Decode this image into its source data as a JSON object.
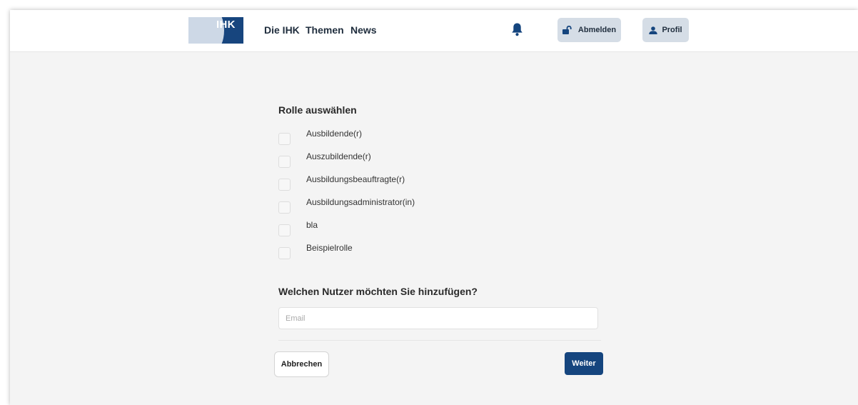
{
  "header": {
    "logo_text": "IHK",
    "nav": [
      "Die IHK",
      "Themen",
      "News"
    ],
    "logout_label": "Abmelden",
    "profile_label": "Profil"
  },
  "roles": {
    "title": "Rolle auswählen",
    "items": [
      {
        "label": "Ausbildende(r)",
        "checked": false
      },
      {
        "label": "Auszubildende(r)",
        "checked": false
      },
      {
        "label": "Ausbildungsbeauftragte(r)",
        "checked": false
      },
      {
        "label": "Ausbildungsadministrator(in)",
        "checked": false
      },
      {
        "label": "bla",
        "checked": false
      },
      {
        "label": "Beispielrolle",
        "checked": false
      }
    ]
  },
  "user": {
    "title": "Welchen Nutzer möchten Sie hinzufügen?",
    "email_placeholder": "Email",
    "email_value": ""
  },
  "actions": {
    "cancel_label": "Abbrechen",
    "next_label": "Weiter"
  },
  "colors": {
    "brand_blue": "#15457e",
    "logo_light": "#cdd8e6",
    "header_button_bg": "#d5dde6"
  }
}
